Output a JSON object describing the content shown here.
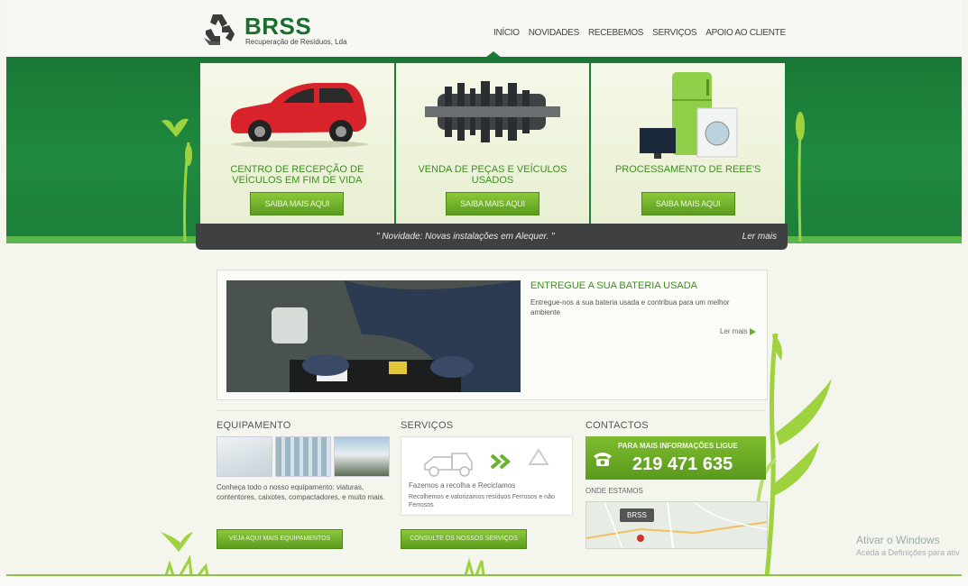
{
  "brand": {
    "name": "BRSS",
    "tagline": "Recuperação de Resíduos, Lda"
  },
  "nav": [
    "INÍCIO",
    "NOVIDADES",
    "RECEBEMOS",
    "SERVIÇOS",
    "APOIO AO CLIENTE"
  ],
  "cards": [
    {
      "title": "CENTRO DE RECEPÇÃO DE VEÍCULOS EM FIM DE VIDA",
      "button": "SAIBA MAIS AQUI",
      "image": "red-car"
    },
    {
      "title": "VENDA DE PEÇAS E VEÍCULOS USADOS",
      "button": "SAIBA MAIS AQUI",
      "image": "gearbox"
    },
    {
      "title": "PROCESSAMENTO DE REEE'S",
      "button": "SAIBA MAIS AQUI",
      "image": "appliances"
    }
  ],
  "ticker": {
    "text": "\" Novidade: Novas instalações em Alequer. \"",
    "more": "Ler mais"
  },
  "feature": {
    "title": "ENTREGUE A SUA BATERIA USADA",
    "text": "Entregue-nos a sua bateria usada e contribua para um melhor ambiente",
    "more": "Ler mais"
  },
  "equipment": {
    "title": "EQUIPAMENTO",
    "text": "Conheça todo o nosso equipamento: viaturas, contentores, caixotes, compactadores, e muito mais.",
    "button": "VEJA AQUI MAIS EQUIPAMENTOS"
  },
  "services": {
    "title": "SERVIÇOS",
    "line1": "Fazemos a recolha e Reciclamos",
    "line2": "Recolhemos e valorizamos resíduos Ferrosos e não Ferrosos",
    "button": "CONSULTE OS NOSSOS SERVIÇOS"
  },
  "contacts": {
    "title": "CONTACTOS",
    "phone_label": "PARA MAIS INFORMAÇÕES LIGUE",
    "phone": "219 471 635",
    "where": "ONDE ESTAMOS",
    "map_label": "BRSS"
  },
  "windows_watermark": {
    "line1": "Ativar o Windows",
    "line2": "Aceda a Definições para ativ"
  },
  "colors": {
    "brand_green": "#1a7836",
    "accent_green": "#6bb22c",
    "ticker_bg": "#3f4140"
  }
}
